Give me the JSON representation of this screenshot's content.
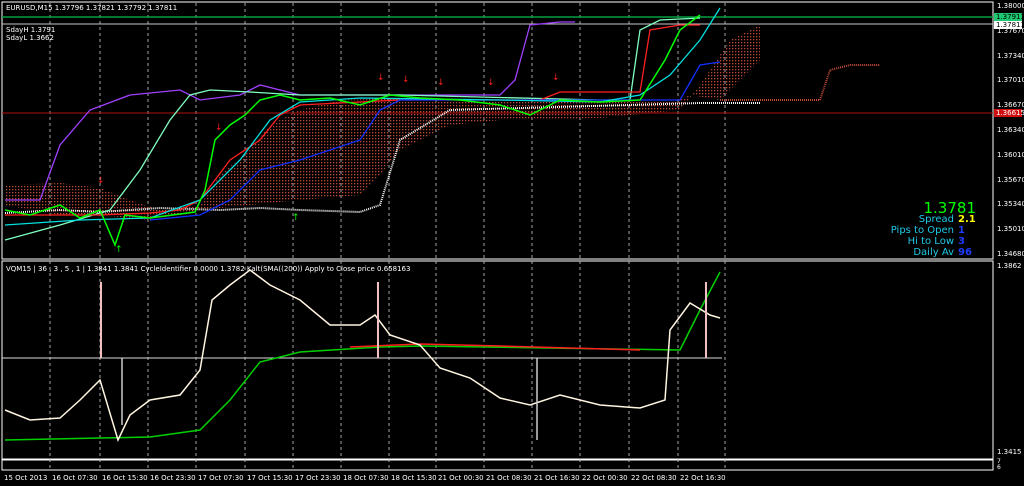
{
  "chart": {
    "symbol_header": "EURUSD,M15  1.37796 1.37821 1.37792 1.37811",
    "sday_high": "SdayH 1.3791",
    "sday_low": "SdayL 1.3662"
  },
  "price_axis": [
    "1.38000",
    "1.37670",
    "1.37340",
    "1.37010",
    "1.36670",
    "1.36340",
    "1.36010",
    "1.35670",
    "1.35340",
    "1.35010",
    "1.34680"
  ],
  "price_tags": {
    "green": "1.37913",
    "white": "1.37811",
    "red": "1.36615"
  },
  "info_panel": {
    "price": "1.3781",
    "rows": [
      {
        "label": "Spread",
        "value": "2.1",
        "color": "#ffff00"
      },
      {
        "label": "Pips to Open",
        "value": "1",
        "color": "#1e3cff"
      },
      {
        "label": "Hi to Low",
        "value": "3",
        "color": "#1e3cff"
      },
      {
        "label": "Daily Av",
        "value": "96",
        "color": "#1e3cff"
      }
    ]
  },
  "sub_window": {
    "header": "VQM15 | 36 , 3 , 5 , 1 |  1.3841 1.3841  CycleIdentifier 0.0000 1.3782  Kalt(SMA((200)) Apply to Close price 0.658163",
    "axis_top": "1.3862",
    "axis_bottom": "1.3415",
    "mini_axis_top": "7",
    "mini_axis_bottom": "6"
  },
  "time_axis": [
    "15 Oct 2013",
    "16 Oct 07:30",
    "16 Oct 15:30",
    "16 Oct 23:30",
    "17 Oct 07:30",
    "17 Oct 15:30",
    "17 Oct 23:30",
    "18 Oct 07:30",
    "18 Oct 15:30",
    "21 Oct 00:30",
    "21 Oct 08:30",
    "21 Oct 16:30",
    "22 Oct 00:30",
    "22 Oct 08:30",
    "22 Oct 16:30"
  ],
  "colors": {
    "bg": "#000000",
    "price": "#00ff00",
    "green_line": "#00a040",
    "red_line": "#ff0000",
    "cloud": "#b04030",
    "ma_blue": "#0000ff",
    "ma_cyan": "#00e0e0",
    "purple": "#a040ff"
  }
}
